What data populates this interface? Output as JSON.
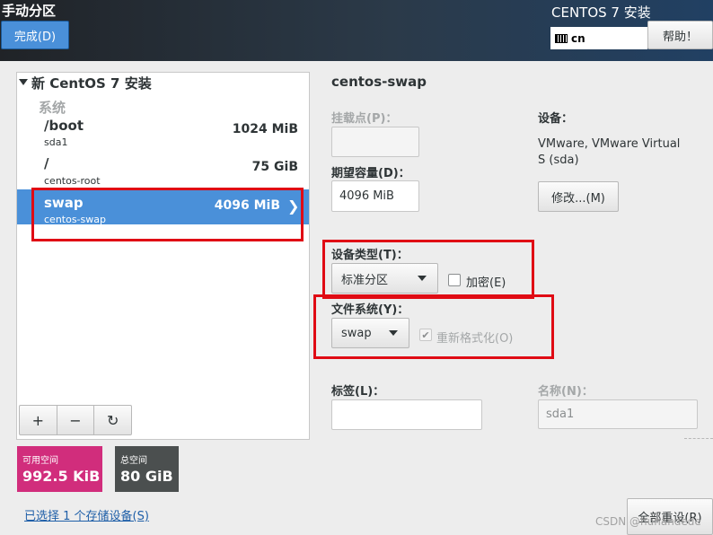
{
  "header": {
    "title": "手动分区",
    "done_label": "完成(D)",
    "product": "CENTOS 7 安装",
    "keyboard_layout": "cn",
    "help_label": "帮助！"
  },
  "left_panel": {
    "install_title": "新 CentOS 7 安装",
    "section_label": "系统",
    "rows": [
      {
        "name": "/boot",
        "device": "sda1",
        "size": "1024 MiB"
      },
      {
        "name": "/",
        "device": "centos-root",
        "size": "75 GiB"
      },
      {
        "name": "swap",
        "device": "centos-swap",
        "size": "4096 MiB"
      }
    ],
    "toolbar": {
      "add": "+",
      "remove": "−",
      "refresh": "↻"
    }
  },
  "space": {
    "available_label": "可用空间",
    "available_value": "992.5 KiB",
    "total_label": "总空间",
    "total_value": "80 GiB"
  },
  "storage_link": "已选择 1 个存储设备(S)",
  "detail": {
    "title": "centos-swap",
    "mount_label": "挂载点(P)：",
    "mount_value": "",
    "capacity_label": "期望容量(D)：",
    "capacity_value": "4096 MiB",
    "device_label": "设备：",
    "device_value": "VMware, VMware Virtual S (sda)",
    "modify_label": "修改...(M)",
    "device_type_label": "设备类型(T)：",
    "device_type_value": "标准分区",
    "encrypt_label": "加密(E)",
    "fs_label": "文件系统(Y)：",
    "fs_value": "swap",
    "reformat_label": "重新格式化(O)",
    "tag_label": "标签(L)：",
    "tag_value": "",
    "name_label": "名称(N)：",
    "name_value": "sda1",
    "reset_label": "全部重设(R)"
  },
  "watermark": "CSDN @hunandede",
  "colors": {
    "accent": "#4a90d9",
    "available": "#d12d7c",
    "total": "#4b4f4f",
    "highlight": "#e00b14"
  }
}
